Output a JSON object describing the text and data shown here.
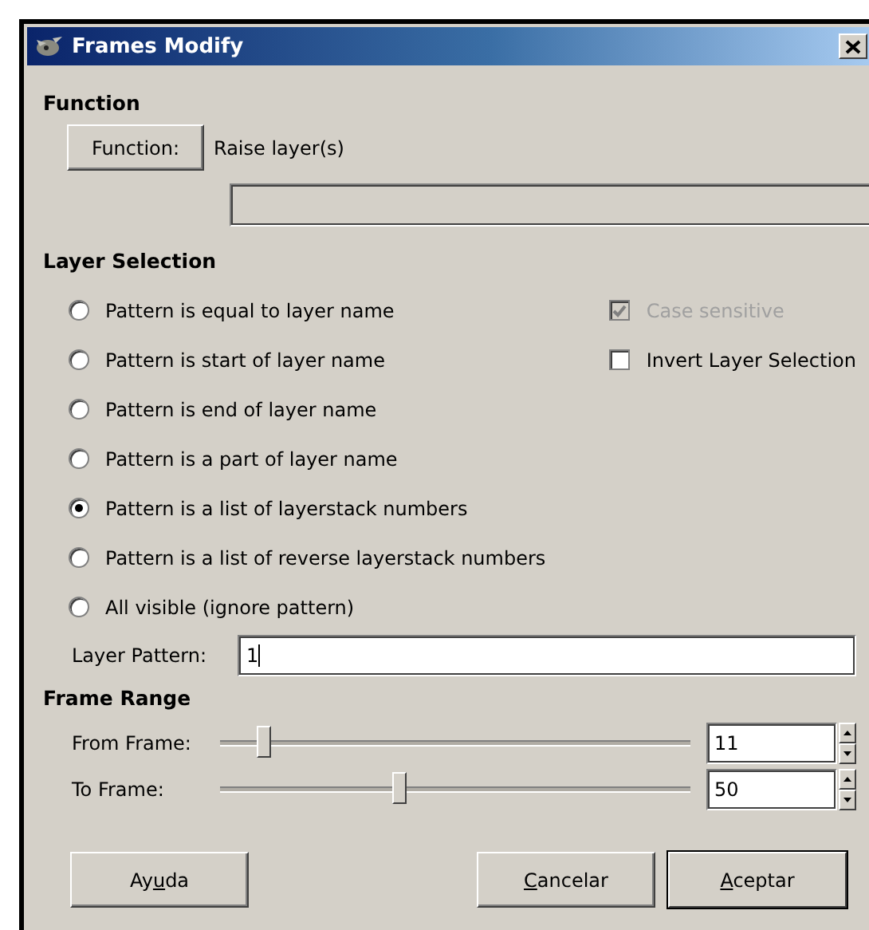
{
  "window": {
    "title": "Frames Modify"
  },
  "function_section": {
    "heading": "Function",
    "button": "Function:",
    "value": "Raise layer(s)"
  },
  "layer_selection": {
    "heading": "Layer Selection",
    "options": [
      {
        "label": "Pattern is equal to layer name",
        "selected": false
      },
      {
        "label": "Pattern is start of layer name",
        "selected": false
      },
      {
        "label": "Pattern is end of layer name",
        "selected": false
      },
      {
        "label": "Pattern is a part of layer name",
        "selected": false
      },
      {
        "label": "Pattern is a list of layerstack numbers",
        "selected": true
      },
      {
        "label": "Pattern is a list of reverse layerstack numbers",
        "selected": false
      },
      {
        "label": "All visible (ignore pattern)",
        "selected": false
      }
    ],
    "checkboxes": [
      {
        "label": "Case sensitive",
        "checked": true,
        "disabled": true
      },
      {
        "label": "Invert Layer Selection",
        "checked": false,
        "disabled": false
      }
    ],
    "pattern_label": "Layer Pattern:",
    "pattern_value": "1"
  },
  "frame_range": {
    "heading": "Frame Range",
    "sliders": [
      {
        "label": "From Frame:",
        "level": 0.09,
        "value": "11"
      },
      {
        "label": "To Frame:",
        "level": 0.38,
        "value": "50"
      }
    ]
  },
  "buttons": [
    {
      "label_before": "Ay",
      "mnemonic": "u",
      "label_after": "da",
      "default": false
    },
    {
      "mnemonic": "C",
      "label_after": "ancelar",
      "default": false
    },
    {
      "mnemonic": "A",
      "label_after": "ceptar",
      "default": true
    }
  ]
}
